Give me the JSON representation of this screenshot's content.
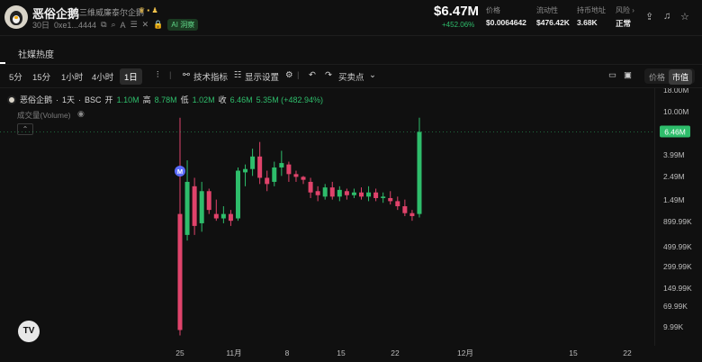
{
  "header": {
    "token_name": "恶俗企鹅",
    "token_fullname": "三维威廉泰尔企鹅",
    "age": "30日",
    "address": "0xe1...4444",
    "ai_badge": "AI 洞察",
    "price": "$6.47M",
    "price_change": "+452.06%",
    "stats": [
      {
        "label": "价格",
        "value": "$0.0064642"
      },
      {
        "label": "流动性",
        "value": "$476.42K"
      },
      {
        "label": "持币地址",
        "value": "3.68K"
      },
      {
        "label": "风险",
        "value": "正常"
      }
    ]
  },
  "tabs": [
    {
      "label": "社媒热度"
    }
  ],
  "toolbar": {
    "timeframes": [
      "5分",
      "15分",
      "1小时",
      "4小时",
      "1日"
    ],
    "active_timeframe": "1日",
    "indicators_label": "技术指标",
    "display_label": "显示设置",
    "trade_points_label": "买卖点",
    "toggle_price": "价格",
    "toggle_mcap": "市值"
  },
  "chart_info": {
    "symbol": "恶俗企鹅",
    "interval": "1天",
    "chain": "BSC",
    "open_label": "开",
    "open": "1.10M",
    "high_label": "高",
    "high": "8.78M",
    "low_label": "低",
    "low": "1.02M",
    "close_label": "收",
    "close": "6.46M",
    "change": "5.35M (+482.94%)",
    "volume_label": "成交量(Volume)",
    "marker": "M"
  },
  "chart_data": {
    "type": "candlestick",
    "scale": "log",
    "y_ticks": [
      "18.00M",
      "10.00M",
      "3.99M",
      "2.49M",
      "1.49M",
      "899.99K",
      "499.99K",
      "299.99K",
      "149.99K",
      "69.99K",
      "9.99K"
    ],
    "x_ticks": [
      "25",
      "11月",
      "8",
      "15",
      "22",
      "12月",
      "15",
      "22"
    ],
    "last_price_label": "6.46M",
    "candles": [
      {
        "o": 1.1,
        "h": 8.78,
        "l": 0.08,
        "c": 0.09
      },
      {
        "o": 0.7,
        "h": 3.5,
        "l": 0.62,
        "c": 2.2
      },
      {
        "o": 2.0,
        "h": 2.4,
        "l": 0.7,
        "c": 0.85
      },
      {
        "o": 0.9,
        "h": 2.2,
        "l": 0.75,
        "c": 1.8
      },
      {
        "o": 1.8,
        "h": 1.9,
        "l": 1.1,
        "c": 1.2
      },
      {
        "o": 1.1,
        "h": 1.5,
        "l": 0.95,
        "c": 1.0
      },
      {
        "o": 1.0,
        "h": 1.3,
        "l": 0.9,
        "c": 1.1
      },
      {
        "o": 1.1,
        "h": 1.2,
        "l": 0.85,
        "c": 0.95
      },
      {
        "o": 1.0,
        "h": 3.0,
        "l": 0.95,
        "c": 2.8
      },
      {
        "o": 2.7,
        "h": 3.2,
        "l": 2.0,
        "c": 2.9
      },
      {
        "o": 2.9,
        "h": 4.5,
        "l": 2.5,
        "c": 3.8
      },
      {
        "o": 3.8,
        "h": 5.2,
        "l": 2.1,
        "c": 2.4
      },
      {
        "o": 2.4,
        "h": 2.8,
        "l": 1.8,
        "c": 2.1
      },
      {
        "o": 2.2,
        "h": 3.4,
        "l": 2.0,
        "c": 3.0
      },
      {
        "o": 3.0,
        "h": 4.3,
        "l": 2.5,
        "c": 3.3
      },
      {
        "o": 3.2,
        "h": 3.4,
        "l": 2.2,
        "c": 2.6
      },
      {
        "o": 2.6,
        "h": 2.8,
        "l": 2.2,
        "c": 2.45
      },
      {
        "o": 2.45,
        "h": 2.5,
        "l": 2.1,
        "c": 2.3
      },
      {
        "o": 2.2,
        "h": 2.4,
        "l": 1.55,
        "c": 1.75
      },
      {
        "o": 1.8,
        "h": 2.0,
        "l": 1.45,
        "c": 1.65
      },
      {
        "o": 1.6,
        "h": 2.1,
        "l": 1.5,
        "c": 1.95
      },
      {
        "o": 1.95,
        "h": 2.2,
        "l": 1.5,
        "c": 1.6
      },
      {
        "o": 1.6,
        "h": 2.0,
        "l": 1.45,
        "c": 1.85
      },
      {
        "o": 1.8,
        "h": 1.9,
        "l": 1.5,
        "c": 1.65
      },
      {
        "o": 1.65,
        "h": 1.9,
        "l": 1.55,
        "c": 1.75
      },
      {
        "o": 1.75,
        "h": 1.95,
        "l": 1.5,
        "c": 1.6
      },
      {
        "o": 1.6,
        "h": 2.0,
        "l": 1.45,
        "c": 1.75
      },
      {
        "o": 1.75,
        "h": 1.9,
        "l": 1.45,
        "c": 1.55
      },
      {
        "o": 1.55,
        "h": 1.75,
        "l": 1.4,
        "c": 1.6
      },
      {
        "o": 1.55,
        "h": 1.8,
        "l": 1.35,
        "c": 1.45
      },
      {
        "o": 1.45,
        "h": 1.6,
        "l": 1.2,
        "c": 1.3
      },
      {
        "o": 1.3,
        "h": 1.5,
        "l": 1.05,
        "c": 1.12
      },
      {
        "o": 1.12,
        "h": 1.2,
        "l": 0.95,
        "c": 1.05
      },
      {
        "o": 1.1,
        "h": 8.78,
        "l": 1.02,
        "c": 6.46
      }
    ],
    "colors": {
      "up": "#2ebd6b",
      "down": "#e0436b"
    }
  }
}
